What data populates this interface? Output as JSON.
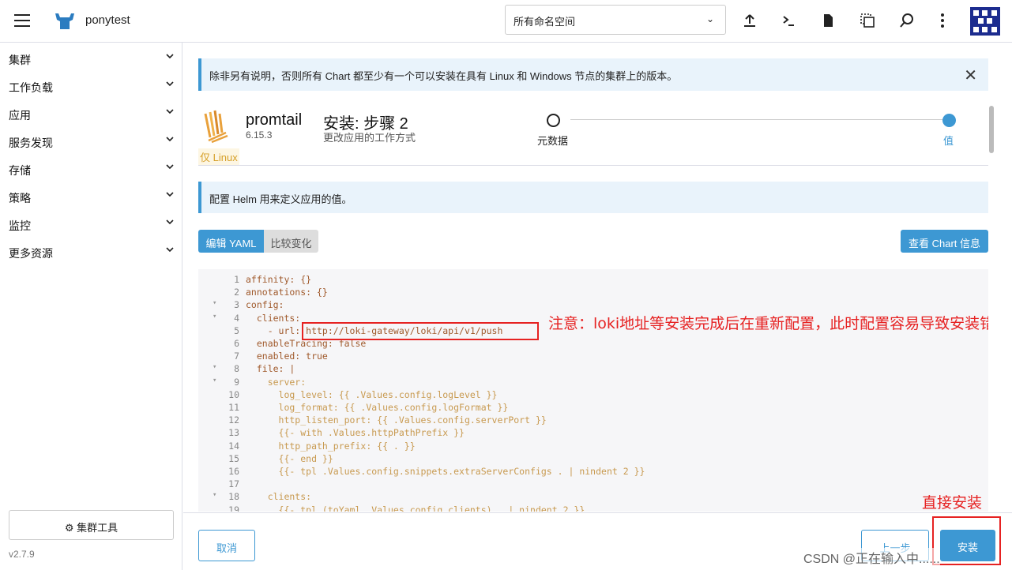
{
  "topbar": {
    "cluster_name": "ponytest",
    "namespace_select": "所有命名空间",
    "icons": [
      "upload-icon",
      "terminal-icon",
      "file-icon",
      "copy-icon",
      "search-icon",
      "more-icon"
    ]
  },
  "sidebar": {
    "items": [
      {
        "label": "集群"
      },
      {
        "label": "工作负载"
      },
      {
        "label": "应用"
      },
      {
        "label": "服务发现"
      },
      {
        "label": "存储"
      },
      {
        "label": "策略"
      },
      {
        "label": "监控"
      },
      {
        "label": "更多资源"
      }
    ],
    "tools_label": "集群工具",
    "version": "v2.7.9"
  },
  "main": {
    "banner1": "除非另有说明，否则所有 Chart 都至少有一个可以安装在具有 Linux 和 Windows 节点的集群上的版本。",
    "chart": {
      "name": "promtail",
      "version": "6.15.3",
      "badge": "仅 Linux"
    },
    "step": {
      "title": "安装: 步骤 2",
      "subtitle": "更改应用的工作方式",
      "step1_label": "元数据",
      "step2_label": "值"
    },
    "banner2": "配置 Helm 用来定义应用的值。",
    "tabs": {
      "yaml": "编辑 YAML",
      "diff": "比较变化"
    },
    "chart_info_button": "查看 Chart 信息",
    "editor_lines": [
      {
        "n": "1",
        "fold": "",
        "text": "affinity: {}"
      },
      {
        "n": "2",
        "fold": "",
        "text": "annotations: {}"
      },
      {
        "n": "3",
        "fold": "▾",
        "text": "config:"
      },
      {
        "n": "4",
        "fold": "▾",
        "text": "  clients:"
      },
      {
        "n": "5",
        "fold": "",
        "text": "    - url: http://loki-gateway/loki/api/v1/push"
      },
      {
        "n": "6",
        "fold": "",
        "text": "  enableTracing: false"
      },
      {
        "n": "7",
        "fold": "",
        "text": "  enabled: true"
      },
      {
        "n": "8",
        "fold": "▾",
        "text": "  file: |"
      },
      {
        "n": "9",
        "fold": "▾",
        "text": "    server:"
      },
      {
        "n": "10",
        "fold": "",
        "text": "      log_level: {{ .Values.config.logLevel }}"
      },
      {
        "n": "11",
        "fold": "",
        "text": "      log_format: {{ .Values.config.logFormat }}"
      },
      {
        "n": "12",
        "fold": "",
        "text": "      http_listen_port: {{ .Values.config.serverPort }}"
      },
      {
        "n": "13",
        "fold": "",
        "text": "      {{- with .Values.httpPathPrefix }}"
      },
      {
        "n": "14",
        "fold": "",
        "text": "      http_path_prefix: {{ . }}"
      },
      {
        "n": "15",
        "fold": "",
        "text": "      {{- end }}"
      },
      {
        "n": "16",
        "fold": "",
        "text": "      {{- tpl .Values.config.snippets.extraServerConfigs . | nindent 2 }}"
      },
      {
        "n": "17",
        "fold": "",
        "text": ""
      },
      {
        "n": "18",
        "fold": "▾",
        "text": "    clients:"
      },
      {
        "n": "19",
        "fold": "",
        "text": "      {{- tpl (toYaml .Values.config.clients) . | nindent 2 }}"
      }
    ],
    "annotation_url": "注意：loki地址等安装完成后在重新配置，此时配置容易导致安装错误",
    "annotation_install": "直接安装"
  },
  "footer": {
    "cancel": "取消",
    "prev": "上一步",
    "install": "安装",
    "watermark": "CSDN @正在输入中......"
  },
  "colors": {
    "accent": "#3d98d3",
    "annotation": "#e62222"
  }
}
